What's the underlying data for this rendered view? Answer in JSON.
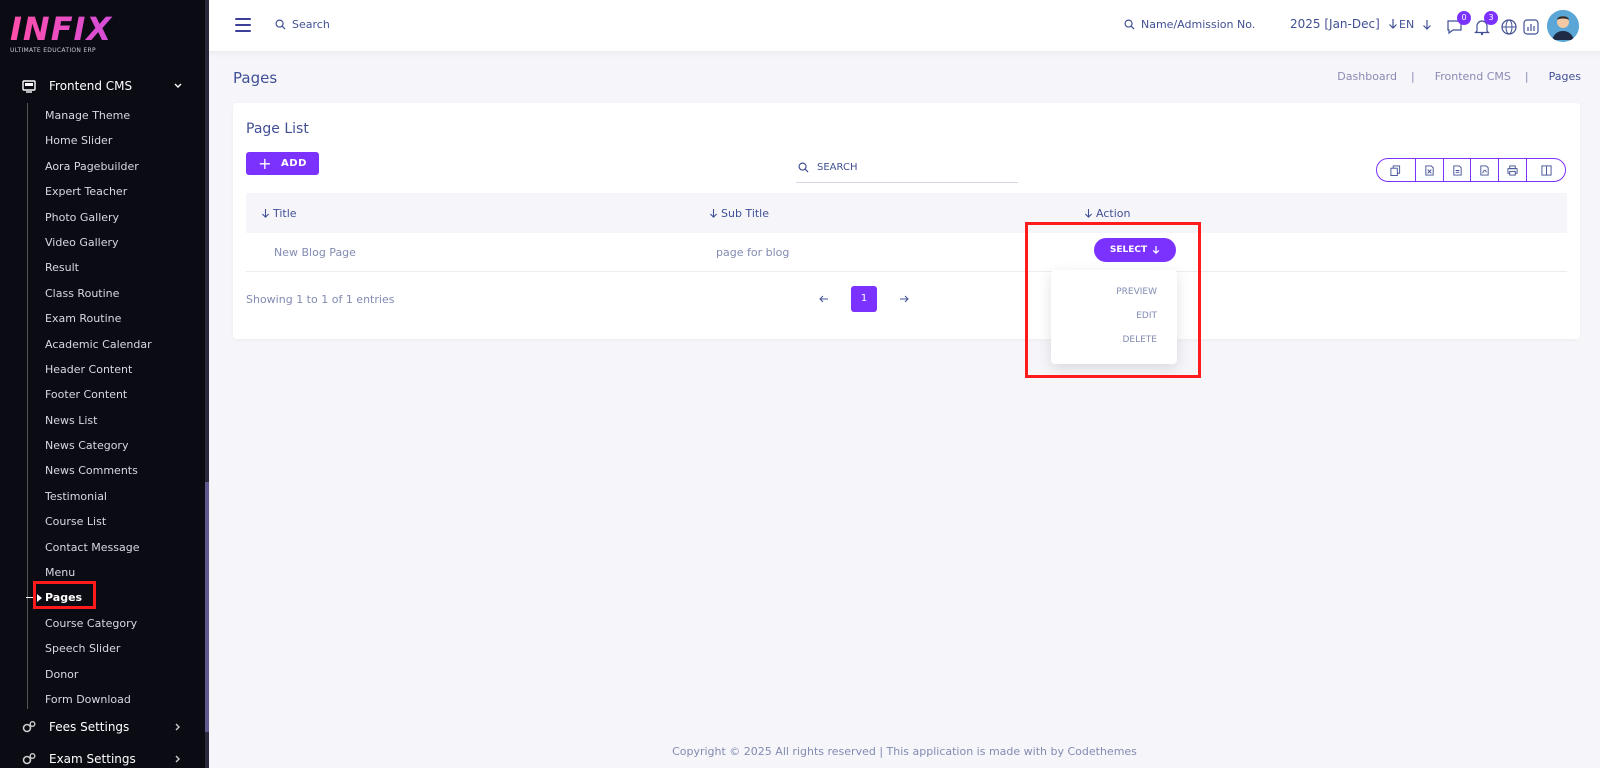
{
  "app": {
    "logo_text": "INFIX",
    "logo_tagline": "ULTIMATE EDUCATION ERP"
  },
  "sidebar": {
    "section": "Frontend CMS",
    "items": [
      "Manage Theme",
      "Home Slider",
      "Aora Pagebuilder",
      "Expert Teacher",
      "Photo Gallery",
      "Video Gallery",
      "Result",
      "Class Routine",
      "Exam Routine",
      "Academic Calendar",
      "Header Content",
      "Footer Content",
      "News List",
      "News Category",
      "News Comments",
      "Testimonial",
      "Course List",
      "Contact Message",
      "Menu",
      "Pages",
      "Course Category",
      "Speech Slider",
      "Donor",
      "Form Download"
    ],
    "active_item": "Pages",
    "more_sections": [
      "Fees Settings",
      "Exam Settings"
    ]
  },
  "header": {
    "search_placeholder": "Search",
    "search2_placeholder": "Name/Admission No.",
    "year": "2025 [Jan-Dec]",
    "lang": "EN",
    "messages_count": "0",
    "notifications_count": "3"
  },
  "page": {
    "title": "Pages",
    "breadcrumb": [
      "Dashboard",
      "Frontend CMS",
      "Pages"
    ]
  },
  "card": {
    "title": "Page List",
    "add_label": "ADD",
    "search_placeholder": "SEARCH",
    "columns": [
      "Title",
      "Sub Title",
      "Action"
    ],
    "rows": [
      {
        "title": "New Blog Page",
        "subtitle": "page for blog",
        "action": "SELECT"
      }
    ],
    "showing": "Showing 1 to 1 of 1 entries",
    "current_page": "1",
    "dropdown": [
      "PREVIEW",
      "EDIT",
      "DELETE"
    ]
  },
  "footer": {
    "text": "Copyright © 2025 All rights reserved | This application is made with by Codethemes"
  },
  "colors": {
    "accent": "#7c32ff",
    "text": "#415094",
    "highlight": "#ff1b1b"
  }
}
